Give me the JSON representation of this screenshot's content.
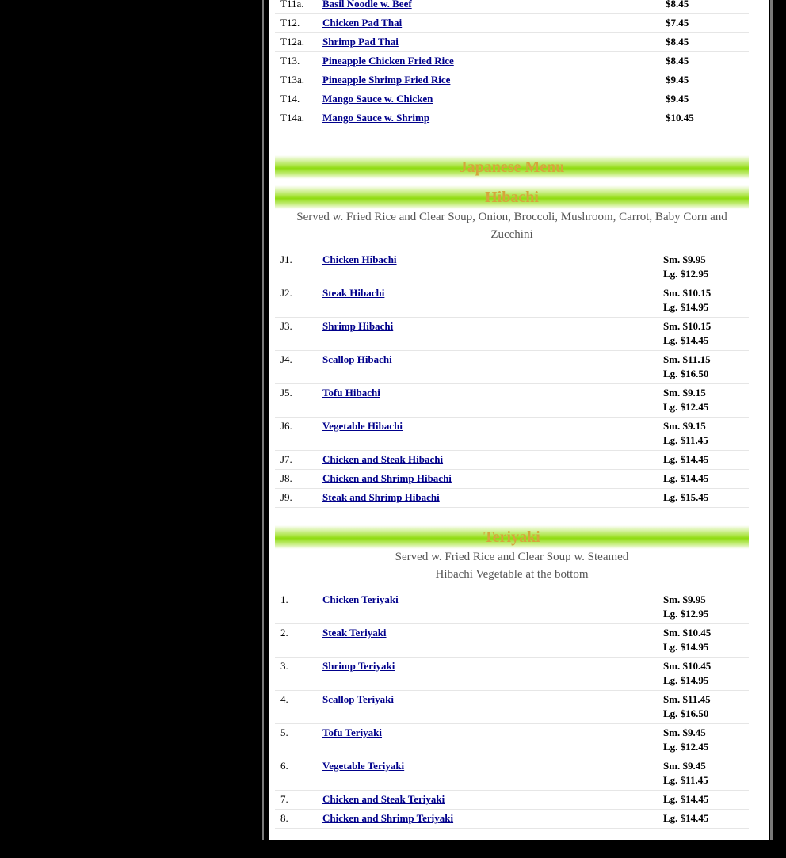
{
  "thai_rows": [
    {
      "code": "T11a.",
      "name": "Basil Noodle w. Beef",
      "price": "$8.45"
    },
    {
      "code": "T12.",
      "name": "Chicken Pad Thai",
      "price": "$7.45"
    },
    {
      "code": "T12a.",
      "name": "Shrimp Pad Thai",
      "price": "$8.45"
    },
    {
      "code": "T13.",
      "name": "Pineapple Chicken Fried Rice",
      "price": "$8.45"
    },
    {
      "code": "T13a.",
      "name": "Pineapple Shrimp Fried Rice",
      "price": "$9.45"
    },
    {
      "code": "T14.",
      "name": "Mango Sauce w. Chicken",
      "price": "$9.45"
    },
    {
      "code": "T14a.",
      "name": "Mango Sauce w. Shrimp",
      "price": "$10.45"
    }
  ],
  "japanese": {
    "title": "Japanese Menu"
  },
  "hibachi": {
    "title": "Hibachi",
    "description": "Served w. Fried Rice and Clear Soup, Onion, Broccoli, Mushroom, Carrot, Baby Corn and Zucchini",
    "rows": [
      {
        "code": "J1.",
        "name": "Chicken Hibachi",
        "small": "Sm. $9.95",
        "large": "Lg. $12.95"
      },
      {
        "code": "J2.",
        "name": "Steak Hibachi",
        "small": "Sm. $10.15",
        "large": "Lg. $14.95"
      },
      {
        "code": "J3.",
        "name": "Shrimp Hibachi",
        "small": "Sm. $10.15",
        "large": "Lg. $14.45"
      },
      {
        "code": "J4.",
        "name": "Scallop Hibachi",
        "small": "Sm. $11.15",
        "large": "Lg. $16.50"
      },
      {
        "code": "J5.",
        "name": "Tofu Hibachi",
        "small": "Sm. $9.15",
        "large": "Lg. $12.45"
      },
      {
        "code": "J6.",
        "name": "Vegetable Hibachi",
        "small": "Sm. $9.15",
        "large": "Lg. $11.45"
      },
      {
        "code": "J7.",
        "name": "Chicken and Steak Hibachi",
        "large": "Lg. $14.45"
      },
      {
        "code": "J8.",
        "name": "Chicken and Shrimp Hibachi",
        "large": "Lg. $14.45"
      },
      {
        "code": "J9.",
        "name": "Steak and Shrimp Hibachi",
        "large": "Lg. $15.45"
      }
    ]
  },
  "teriyaki": {
    "title": "Teriyaki",
    "description_line1": "Served w. Fried Rice and Clear Soup w. Steamed",
    "description_line2": "Hibachi Vegetable at the bottom",
    "rows": [
      {
        "code": "1.",
        "name": "Chicken Teriyaki",
        "small": "Sm. $9.95",
        "large": "Lg. $12.95"
      },
      {
        "code": "2.",
        "name": "Steak Teriyaki",
        "small": "Sm. $10.45",
        "large": "Lg. $14.95"
      },
      {
        "code": "3.",
        "name": "Shrimp Teriyaki",
        "small": "Sm. $10.45",
        "large": "Lg. $14.95"
      },
      {
        "code": "4.",
        "name": "Scallop Teriyaki",
        "small": "Sm. $11.45",
        "large": "Lg. $16.50"
      },
      {
        "code": "5.",
        "name": "Tofu Teriyaki",
        "small": "Sm. $9.45",
        "large": "Lg. $12.45"
      },
      {
        "code": "6.",
        "name": "Vegetable Teriyaki",
        "small": "Sm. $9.45",
        "large": "Lg. $11.45"
      },
      {
        "code": "7.",
        "name": "Chicken and Steak Teriyaki",
        "large": "Lg. $14.45"
      },
      {
        "code": "8.",
        "name": "Chicken and Shrimp Teriyaki",
        "large": "Lg. $14.45"
      }
    ]
  },
  "colors": {
    "link": "#00008b",
    "section_title": "#d6a53c",
    "band_green": "#8fdc10",
    "frame": "#7a7a7a"
  }
}
